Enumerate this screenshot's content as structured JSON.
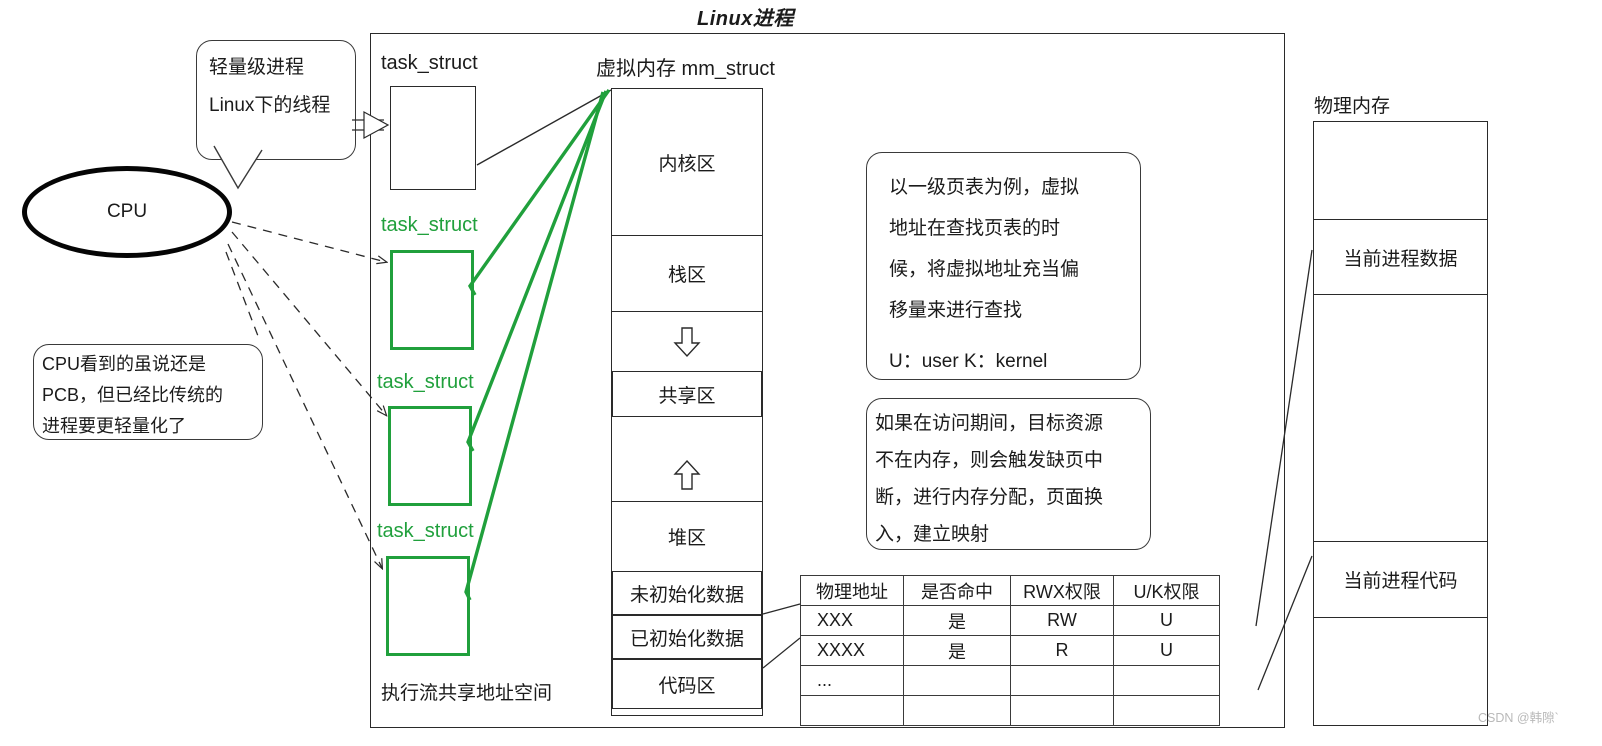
{
  "title": "Linux进程",
  "colors": {
    "green": "#20a03c",
    "ink": "#1b1b1b",
    "border": "#2a2a2a",
    "watermark": "#b9b9b9"
  },
  "cpu": {
    "label": "CPU"
  },
  "callouts": {
    "thread": {
      "name": "轻量级进程 / Linux下的线程",
      "lines": [
        "轻量级进程",
        "Linux下的线程"
      ]
    },
    "pcb": {
      "name": "CPU看到的PCB说明",
      "lines": [
        "CPU看到的虽说还是",
        "PCB，但已经比传统的",
        "进程要更轻量化了"
      ]
    },
    "page_table_note": {
      "name": "一级页表说明",
      "lines": [
        "以一级页表为例，虚拟",
        "地址在查找页表的时",
        "候，将虚拟地址充当偏",
        "移量来进行查找"
      ],
      "footer": "U：user  K：kernel"
    },
    "page_fault_note": {
      "name": "缺页中断说明",
      "lines": [
        "如果在访问期间，目标资源",
        "不在内存，则会触发缺页中",
        "断，进行内存分配，页面换",
        "入，建立映射"
      ]
    }
  },
  "task_structs": [
    {
      "label": "task_struct",
      "color": "black"
    },
    {
      "label": "task_struct",
      "color": "green"
    },
    {
      "label": "task_struct",
      "color": "green"
    },
    {
      "label": "task_struct",
      "color": "green"
    }
  ],
  "exec_flow_label": "执行流共享地址空间",
  "virtual_memory": {
    "title": "虚拟内存 mm_struct",
    "segments": [
      {
        "label": "内核区"
      },
      {
        "label": "栈区"
      },
      {
        "label": "",
        "icon": "arrow-down-icon"
      },
      {
        "label": "共享区"
      },
      {
        "label": "",
        "icon": "arrow-up-icon"
      },
      {
        "label": "堆区"
      },
      {
        "label": "未初始化数据"
      },
      {
        "label": "已初始化数据"
      },
      {
        "label": "代码区"
      },
      {
        "label": ""
      }
    ]
  },
  "page_table": {
    "headers": [
      "物理地址",
      "是否命中",
      "RWX权限",
      "U/K权限"
    ],
    "rows": [
      [
        "XXX",
        "是",
        "RW",
        "U"
      ],
      [
        "XXXX",
        "是",
        "R",
        "U"
      ],
      [
        "...",
        "",
        "",
        ""
      ],
      [
        "",
        "",
        "",
        ""
      ]
    ]
  },
  "physical_memory": {
    "title": "物理内存",
    "segments": [
      {
        "label": ""
      },
      {
        "label": "当前进程数据"
      },
      {
        "label": ""
      },
      {
        "label": "当前进程代码"
      },
      {
        "label": ""
      }
    ]
  },
  "watermark": "CSDN @韩隙`"
}
